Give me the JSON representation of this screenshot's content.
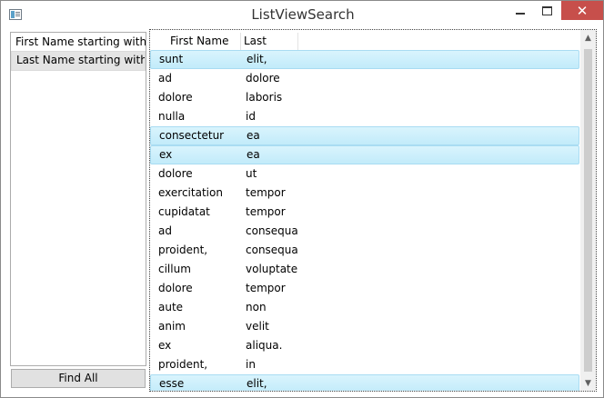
{
  "window": {
    "title": "ListViewSearch",
    "close_glyph": "✕"
  },
  "sidebar": {
    "items": [
      {
        "label": "First Name starting with A"
      },
      {
        "label": "Last Name starting with E"
      }
    ],
    "find_all_label": "Find All"
  },
  "listview": {
    "columns": [
      "First Name",
      "Last Name"
    ],
    "rows": [
      {
        "first": "sunt",
        "last": "elit,",
        "selected": true
      },
      {
        "first": "ad",
        "last": "dolore",
        "selected": false
      },
      {
        "first": "dolore",
        "last": "laboris",
        "selected": false
      },
      {
        "first": "nulla",
        "last": "id",
        "selected": false
      },
      {
        "first": "consectetur",
        "last": "ea",
        "selected": true
      },
      {
        "first": "ex",
        "last": "ea",
        "selected": true
      },
      {
        "first": "dolore",
        "last": "ut",
        "selected": false
      },
      {
        "first": "exercitation",
        "last": "tempor",
        "selected": false
      },
      {
        "first": "cupidatat",
        "last": "tempor",
        "selected": false
      },
      {
        "first": "ad",
        "last": "consequa",
        "selected": false
      },
      {
        "first": "proident,",
        "last": "consequa",
        "selected": false
      },
      {
        "first": "cillum",
        "last": "voluptate",
        "selected": false
      },
      {
        "first": "dolore",
        "last": "tempor",
        "selected": false
      },
      {
        "first": "aute",
        "last": "non",
        "selected": false
      },
      {
        "first": "anim",
        "last": "velit",
        "selected": false
      },
      {
        "first": "ex",
        "last": "aliqua.",
        "selected": false
      },
      {
        "first": "proident,",
        "last": "in",
        "selected": false
      },
      {
        "first": "esse",
        "last": "elit,",
        "selected": true
      }
    ]
  },
  "scrollbar": {
    "up_glyph": "▲",
    "down_glyph": "▼"
  },
  "colors": {
    "selection": "#cbeefb",
    "close_button": "#c74f4b"
  }
}
